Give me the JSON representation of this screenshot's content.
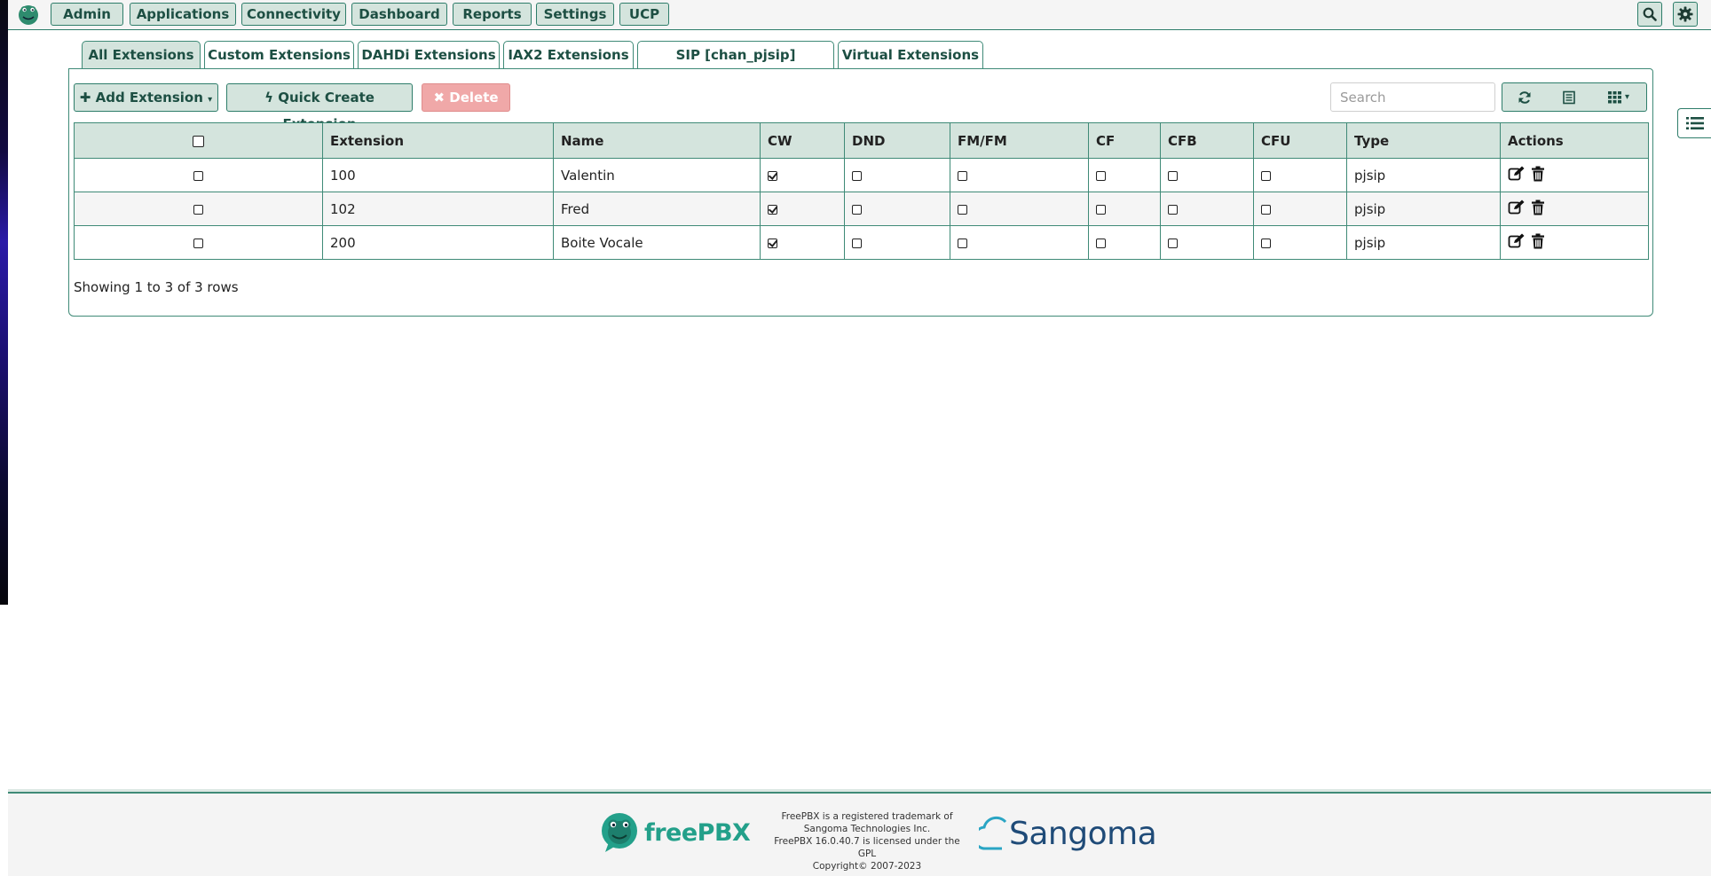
{
  "nav": {
    "menus": [
      "Admin",
      "Applications",
      "Connectivity",
      "Dashboard",
      "Reports",
      "Settings",
      "UCP"
    ],
    "icons": [
      "search-icon",
      "gear-icon"
    ]
  },
  "tabs": [
    {
      "label": "All Extensions",
      "active": true
    },
    {
      "label": "Custom Extensions",
      "active": false
    },
    {
      "label": "DAHDi Extensions",
      "active": false
    },
    {
      "label": "IAX2 Extensions",
      "active": false
    },
    {
      "label": "SIP [chan_pjsip] Extensions",
      "active": false
    },
    {
      "label": "Virtual Extensions",
      "active": false
    }
  ],
  "toolbar": {
    "add_label": "Add Extension",
    "quick_create_label": "Quick Create Extension",
    "delete_label": "Delete",
    "search_placeholder": "Search"
  },
  "table": {
    "columns": [
      "",
      "Extension",
      "Name",
      "CW",
      "DND",
      "FM/FM",
      "CF",
      "CFB",
      "CFU",
      "Type",
      "Actions"
    ],
    "rows": [
      {
        "extension": "100",
        "name": "Valentin",
        "cw": true,
        "dnd": false,
        "fmfm": false,
        "cf": false,
        "cfb": false,
        "cfu": false,
        "type": "pjsip"
      },
      {
        "extension": "102",
        "name": "Fred",
        "cw": true,
        "dnd": false,
        "fmfm": false,
        "cf": false,
        "cfb": false,
        "cfu": false,
        "type": "pjsip"
      },
      {
        "extension": "200",
        "name": "Boite Vocale",
        "cw": true,
        "dnd": false,
        "fmfm": false,
        "cf": false,
        "cfb": false,
        "cfu": false,
        "type": "pjsip"
      }
    ],
    "summary": "Showing 1 to 3 of 3 rows"
  },
  "footer": {
    "brand": "freePBX",
    "legal_lines": [
      "FreePBX is a registered trademark of",
      "Sangoma Technologies Inc.",
      "FreePBX 16.0.40.7 is licensed under the",
      "GPL",
      "Copyright© 2007-2023"
    ],
    "partner": "Sangoma"
  },
  "colors": {
    "accent": "#2e7d6a",
    "button_bg": "#d4e4dd",
    "delete_bg": "#f0a8a8",
    "brand_green": "#23a08a",
    "sangoma_blue": "#1f4b78"
  }
}
